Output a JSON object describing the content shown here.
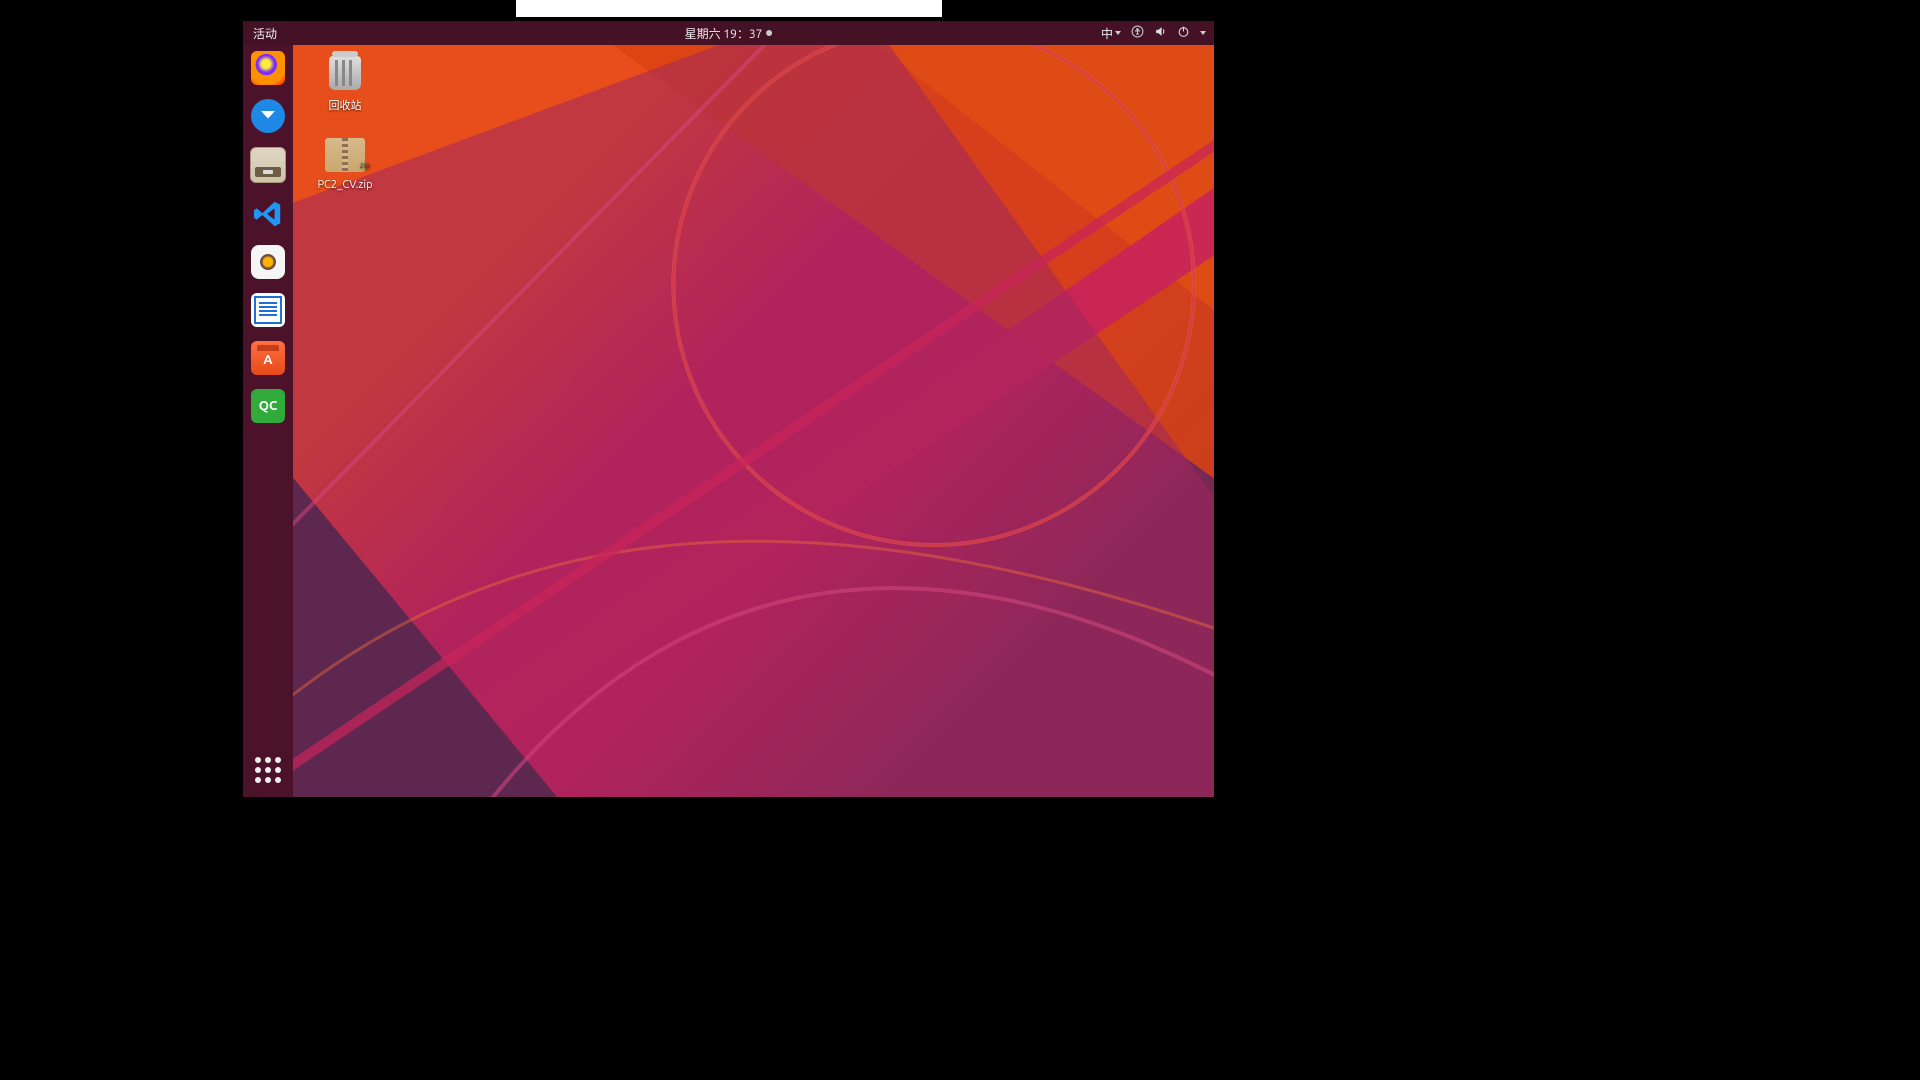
{
  "panel": {
    "activities": "活动",
    "clock": "星期六 19：37",
    "ime_label": "中"
  },
  "dock": {
    "firefox": "Firefox",
    "thunderbird": "Thunderbird",
    "files": "文件",
    "vscode": "Visual Studio Code",
    "rhythmbox": "Rhythmbox",
    "writer": "LibreOffice Writer",
    "software": "Ubuntu Software",
    "qc": "QC",
    "apps": "显示应用程序"
  },
  "desktop_icons": {
    "trash_label": "回收站",
    "zip_label": "PC2_CV.zip"
  }
}
